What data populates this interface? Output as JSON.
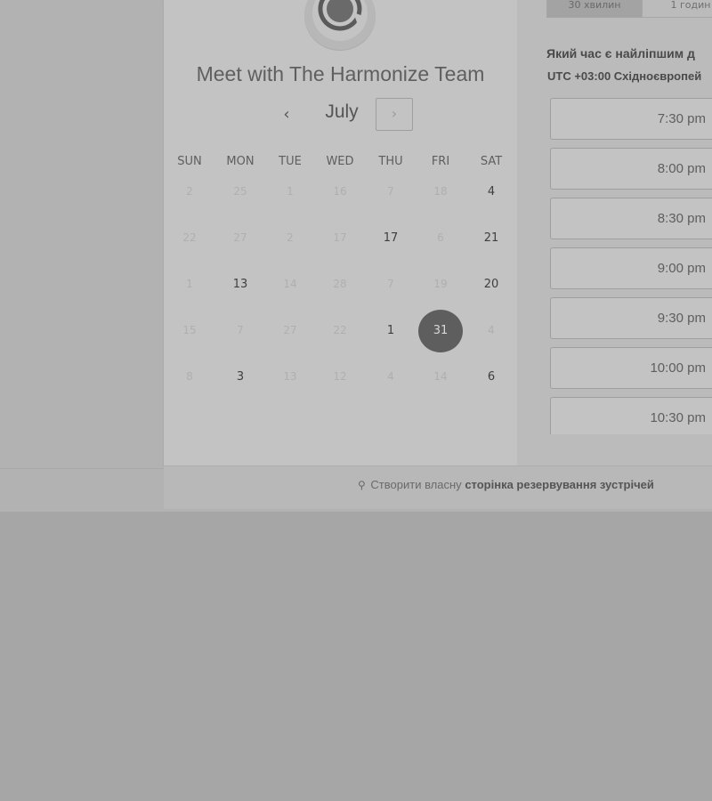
{
  "title": "Meet with The Harmonize Team",
  "calendar": {
    "month": "July",
    "prev_icon": "chevron-left-icon",
    "next_icon": "chevron-right-icon",
    "weekdays": [
      "SUN",
      "MON",
      "TUE",
      "WED",
      "THU",
      "FRI",
      "SAT"
    ],
    "weeks": [
      [
        "2",
        "25",
        "1",
        "16",
        "7",
        "18",
        "4"
      ],
      [
        "22",
        "27",
        "2",
        "17",
        "17",
        "6",
        "21"
      ],
      [
        "1",
        "13",
        "14",
        "28",
        "7",
        "19",
        "20"
      ],
      [
        "15",
        "7",
        "27",
        "22",
        "1",
        "31",
        "4"
      ],
      [
        "8",
        "3",
        "13",
        "12",
        "4",
        "14",
        "6"
      ]
    ],
    "available": [
      [
        0,
        6
      ],
      [
        1,
        4
      ],
      [
        1,
        6
      ],
      [
        2,
        1
      ],
      [
        2,
        6
      ],
      [
        3,
        4
      ],
      [
        4,
        1
      ],
      [
        4,
        6
      ]
    ],
    "selected": [
      3,
      5
    ]
  },
  "durations": [
    "30 хвилин",
    "1 годин"
  ],
  "active_duration": 0,
  "question": "Який час є найліпшим д",
  "timezone": {
    "offset": "UTC +03:00",
    "name": "Східноєвропей"
  },
  "slots": [
    "7:30 pm",
    "8:00 pm",
    "8:30 pm",
    "9:00 pm",
    "9:30 pm",
    "10:00 pm",
    "10:30 pm"
  ],
  "footer": {
    "prefix": "Створити власну",
    "link": "сторінка резервування зустрічей"
  },
  "colors": {
    "selected_day": "#5e5e5e",
    "overlay": "#a6a6a6"
  }
}
